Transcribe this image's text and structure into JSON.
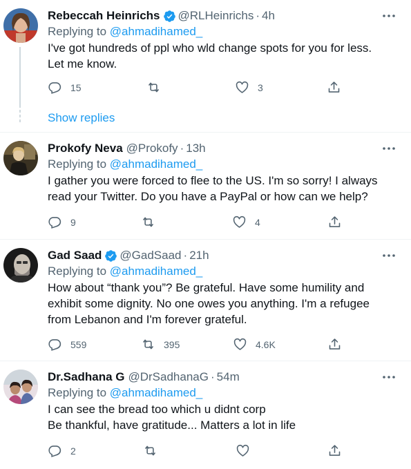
{
  "tweets": [
    {
      "name": "Rebeccah Heinrichs",
      "verified": true,
      "handle": "@RLHeinrichs",
      "time": "4h",
      "replying_label": "Replying to ",
      "replying_to": "@ahmadihamed_",
      "text": "I've got hundreds of ppl who wld change spots for you for less. Let me know.",
      "replies": "15",
      "retweets": "",
      "likes": "3"
    },
    {
      "name": "Prokofy Neva",
      "verified": false,
      "handle": "@Prokofy",
      "time": "13h",
      "replying_label": "Replying to ",
      "replying_to": "@ahmadihamed_",
      "text": "I gather you were forced to flee to the US. I'm so sorry! I always read your Twitter. Do you have a PayPal or how can we help?",
      "replies": "9",
      "retweets": "",
      "likes": "4"
    },
    {
      "name": "Gad Saad",
      "verified": true,
      "handle": "@GadSaad",
      "time": "21h",
      "replying_label": "Replying to ",
      "replying_to": "@ahmadihamed_",
      "text": "How about “thank you”? Be grateful. Have some humility and exhibit some dignity. No one owes you anything. I'm a refugee from Lebanon and I'm forever grateful.",
      "replies": "559",
      "retweets": "395",
      "likes": "4.6K"
    },
    {
      "name": "Dr.Sadhana G",
      "verified": false,
      "handle": "@DrSadhanaG",
      "time": "54m",
      "replying_label": "Replying to ",
      "replying_to": "@ahmadihamed_",
      "text": "I can see the bread too which u didnt corp\nBe thankful, have gratitude... Matters a lot in life",
      "replies": "2",
      "retweets": "",
      "likes": ""
    }
  ],
  "show_replies": "Show replies",
  "separator": "·",
  "colors": {
    "accent": "#1d9bf0",
    "muted": "#536471",
    "text": "#0f1419",
    "divider": "#eff3f4"
  }
}
